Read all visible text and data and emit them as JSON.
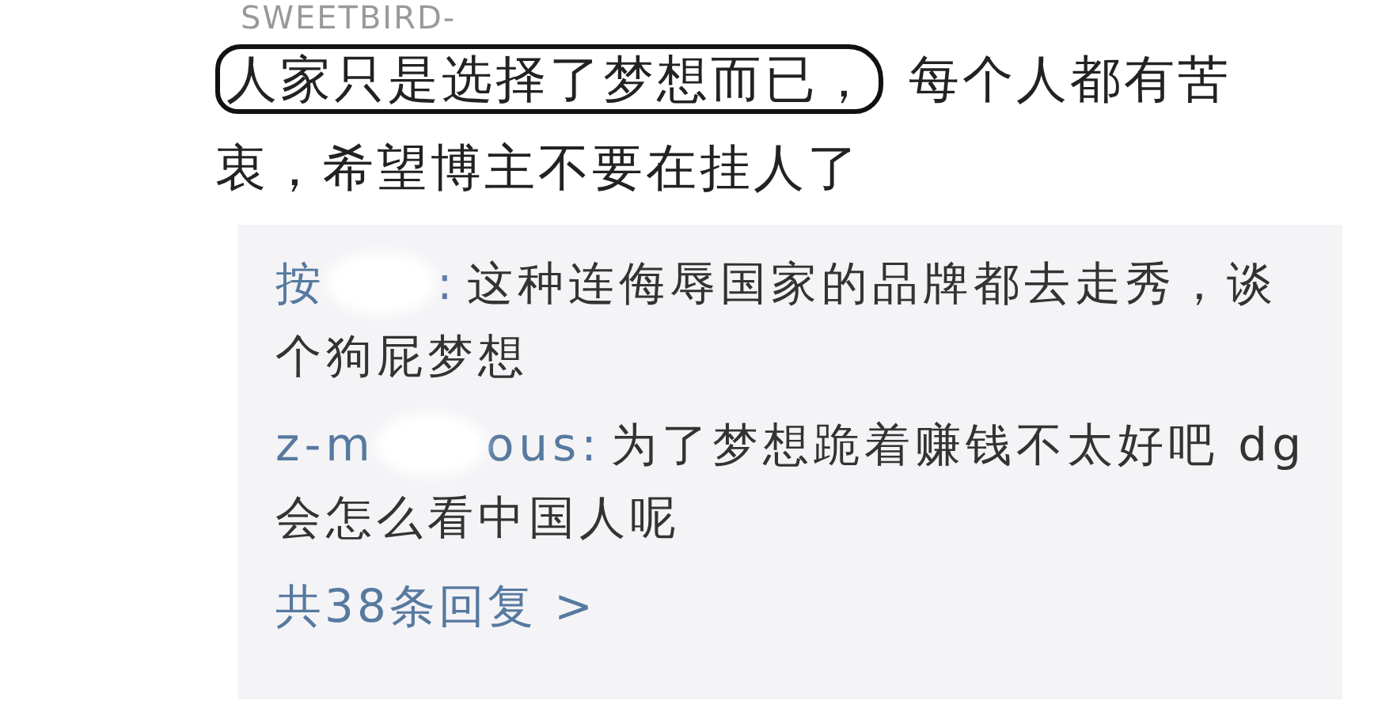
{
  "comment": {
    "author": "SWEETBIRD-",
    "highlighted_text": "人家只是选择了梦想而已，",
    "text": "每个人都有苦衷，希望博主不要在挂人了"
  },
  "replies": [
    {
      "name_parts": [
        "按",
        ":"
      ],
      "text_lines": [
        "这种连侮辱国家的品牌都去走秀，谈",
        "个狗屁梦想"
      ]
    },
    {
      "name_parts": [
        "z-m",
        "ous:"
      ],
      "text_lines": [
        "为了梦想跪着赚钱不太好吧  dg",
        "会怎么看中国人呢"
      ]
    }
  ],
  "more_replies": "共38条回复 >"
}
